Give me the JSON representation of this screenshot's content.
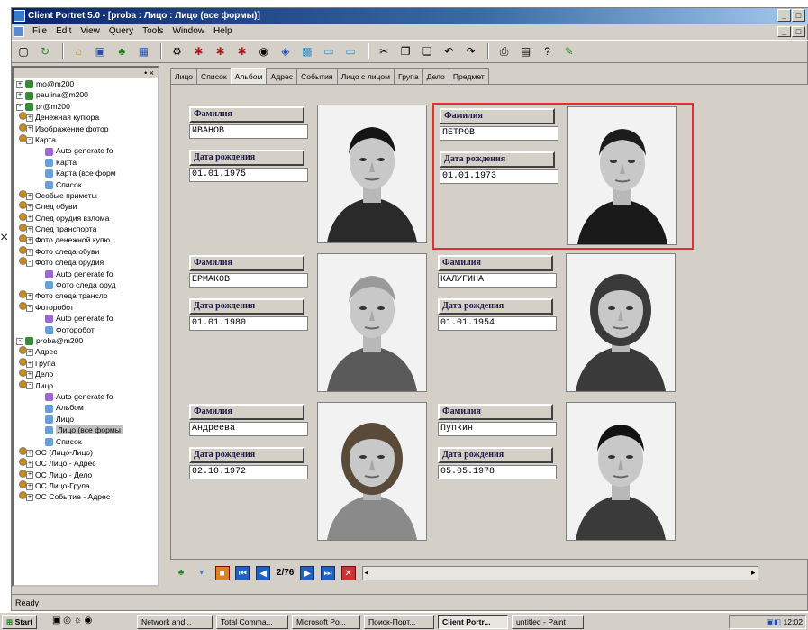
{
  "window": {
    "title": "Client Portret 5.0 - [proba : Лицо : Лицо (все формы)]"
  },
  "menu": [
    "File",
    "Edit",
    "View",
    "Query",
    "Tools",
    "Window",
    "Help"
  ],
  "tree": {
    "header": "• ×",
    "nodes": [
      {
        "text": "mo@m200",
        "level": 0,
        "icon": "server",
        "ex": "+"
      },
      {
        "text": "paulina@m200",
        "level": 0,
        "icon": "server",
        "ex": "+"
      },
      {
        "text": "pr@m200",
        "level": 0,
        "icon": "server",
        "ex": "-"
      },
      {
        "text": "Денежная купюра",
        "level": 1,
        "icon": "folder",
        "ex": "+"
      },
      {
        "text": "Изображение фотор",
        "level": 1,
        "icon": "folder",
        "ex": "+"
      },
      {
        "text": "Карта",
        "level": 1,
        "icon": "folder",
        "ex": "-"
      },
      {
        "text": "Auto generate fo",
        "level": 2,
        "icon": "generate"
      },
      {
        "text": "Карта",
        "level": 2,
        "icon": "doc"
      },
      {
        "text": "Карта (все форм",
        "level": 2,
        "icon": "doc"
      },
      {
        "text": "Список",
        "level": 2,
        "icon": "doc"
      },
      {
        "text": "Особые приметы",
        "level": 1,
        "icon": "folder",
        "ex": "+"
      },
      {
        "text": "След обуви",
        "level": 1,
        "icon": "folder",
        "ex": "+"
      },
      {
        "text": "След орудия взлома",
        "level": 1,
        "icon": "folder",
        "ex": "+"
      },
      {
        "text": "След транспорта",
        "level": 1,
        "icon": "folder",
        "ex": "+"
      },
      {
        "text": "Фото денежной купю",
        "level": 1,
        "icon": "folder",
        "ex": "+"
      },
      {
        "text": "Фото следа обуви",
        "level": 1,
        "icon": "folder",
        "ex": "+"
      },
      {
        "text": "Фото следа орудия",
        "level": 1,
        "icon": "folder",
        "ex": "-"
      },
      {
        "text": "Auto generate fo",
        "level": 2,
        "icon": "generate"
      },
      {
        "text": "Фото следа оруд",
        "level": 2,
        "icon": "doc"
      },
      {
        "text": "Фото следа трансло",
        "level": 1,
        "icon": "folder",
        "ex": "+"
      },
      {
        "text": "Фоторобот",
        "level": 1,
        "icon": "folder",
        "ex": "-"
      },
      {
        "text": "Auto generate fo",
        "level": 2,
        "icon": "generate"
      },
      {
        "text": "Фоторобот",
        "level": 2,
        "icon": "doc"
      },
      {
        "text": "proba@m200",
        "level": 0,
        "icon": "server",
        "ex": "-"
      },
      {
        "text": "Адрес",
        "level": 1,
        "icon": "folder",
        "ex": "+"
      },
      {
        "text": "Група",
        "level": 1,
        "icon": "folder",
        "ex": "+"
      },
      {
        "text": "Дело",
        "level": 1,
        "icon": "folder",
        "ex": "+"
      },
      {
        "text": "Лицо",
        "level": 1,
        "icon": "folder",
        "ex": "-"
      },
      {
        "text": "Auto generate fo",
        "level": 2,
        "icon": "generate"
      },
      {
        "text": "Альбом",
        "level": 2,
        "icon": "doc"
      },
      {
        "text": "Лицо",
        "level": 2,
        "icon": "doc"
      },
      {
        "text": "Лицо (все формы",
        "level": 2,
        "icon": "doc",
        "selected": true
      },
      {
        "text": "Список",
        "level": 2,
        "icon": "doc"
      },
      {
        "text": "ОС (Лицо-Лицо)",
        "level": 1,
        "icon": "folder",
        "ex": "+"
      },
      {
        "text": "ОС Лицо - Адрес",
        "level": 1,
        "icon": "folder",
        "ex": "+"
      },
      {
        "text": "ОС Лицо - Дело",
        "level": 1,
        "icon": "folder",
        "ex": "+"
      },
      {
        "text": "ОС Лицо-Група",
        "level": 1,
        "icon": "folder",
        "ex": "+"
      },
      {
        "text": "ОС Событие - Адрес",
        "level": 1,
        "icon": "folder",
        "ex": "+"
      }
    ]
  },
  "tabs": [
    "Лицо",
    "Список",
    "Альбом",
    "Адрес",
    "События",
    "Лицо с лицом",
    "Група",
    "Дело",
    "Предмет"
  ],
  "active_tab": 2,
  "cards": [
    {
      "surname_label": "Фамилия",
      "surname": "ИВАНОВ",
      "dob_label": "Дата рождения",
      "dob": "01.01.1975",
      "selected": false
    },
    {
      "surname_label": "Фамилия",
      "surname": "ПЕТРОВ",
      "dob_label": "Дата рождения",
      "dob": "01.01.1973",
      "selected": true
    },
    {
      "surname_label": "Фамилия",
      "surname": "ЕРМАКОВ",
      "dob_label": "Дата рождения",
      "dob": "01.01.1980",
      "selected": false
    },
    {
      "surname_label": "Фамилия",
      "surname": "КАЛУГИНА",
      "dob_label": "Дата рождения",
      "dob": "01.01.1954",
      "selected": false
    },
    {
      "surname_label": "Фамилия",
      "surname": "Андреева",
      "dob_label": "Дата рождения",
      "dob": "02.10.1972",
      "selected": false
    },
    {
      "surname_label": "Фамилия",
      "surname": "Пупкин",
      "dob_label": "Дата рождения",
      "dob": "05.05.1978",
      "selected": false
    }
  ],
  "nav": {
    "page": "2/76"
  },
  "status": {
    "text": "Ready"
  },
  "taskbar": {
    "start": "Start",
    "items": [
      "Network and...",
      "Total Comma...",
      "Microsoft Po...",
      "Поиск-Порт...",
      "Client Portr...",
      "untitled - Paint"
    ],
    "active_item": 4,
    "clock": "12:02"
  }
}
